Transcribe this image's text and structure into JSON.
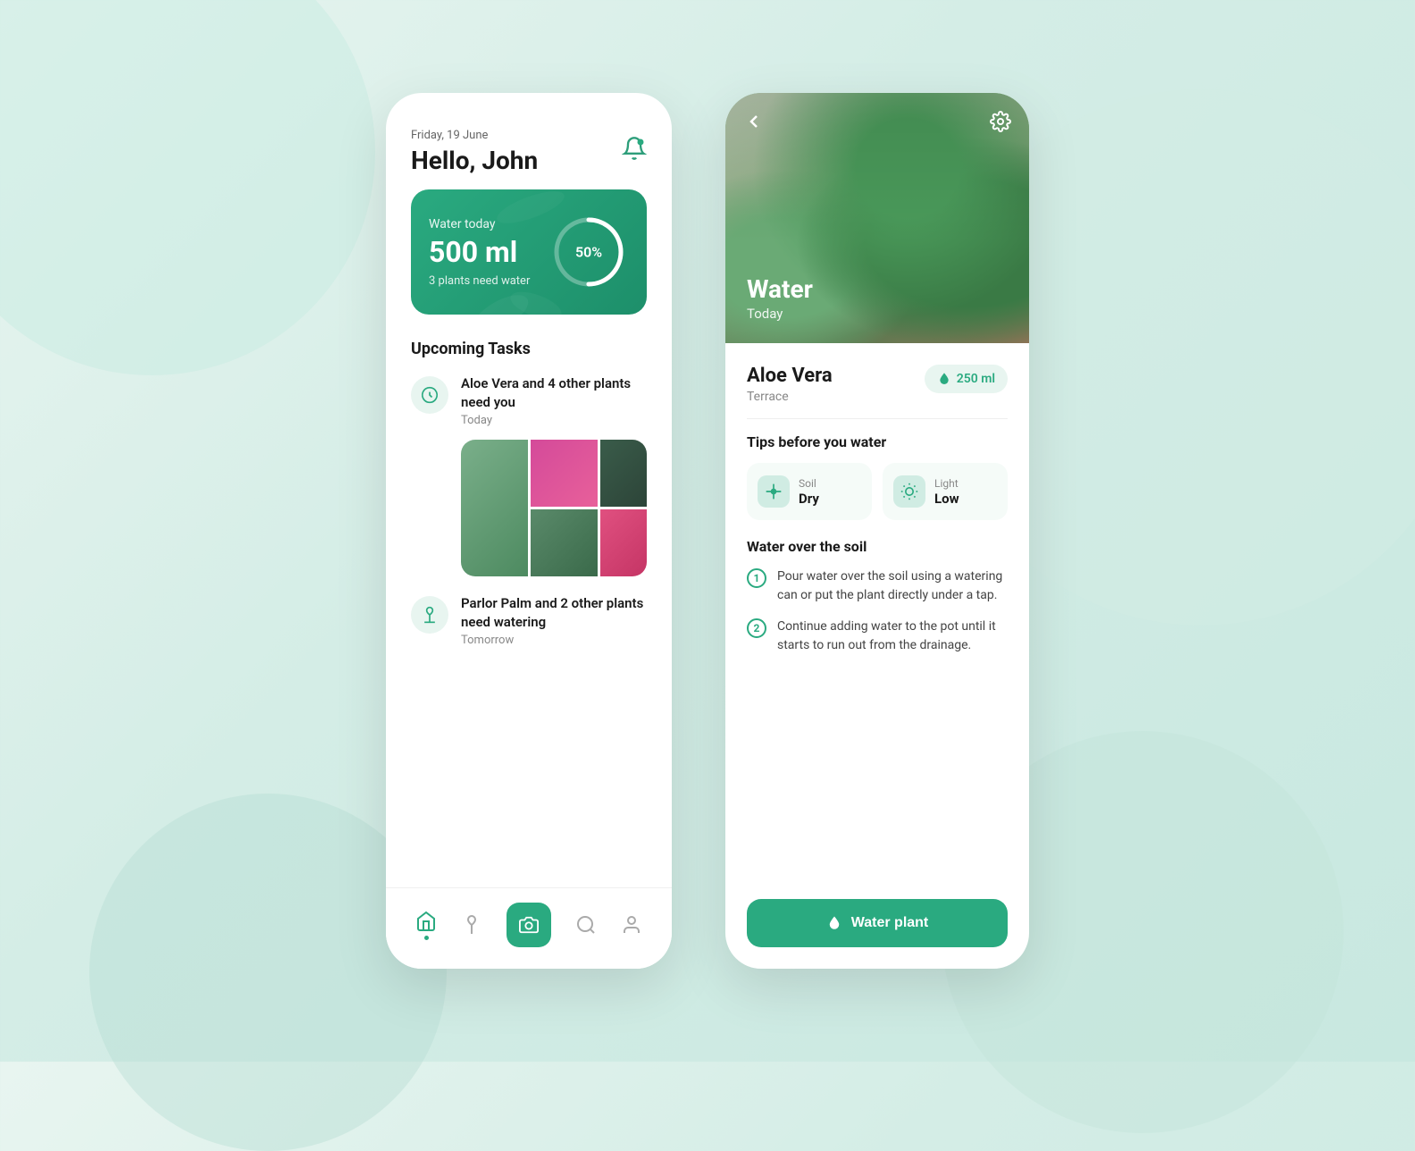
{
  "background": {
    "color": "#d4ede6"
  },
  "phone1": {
    "header": {
      "date": "Friday, 19 June",
      "greeting": "Hello, John"
    },
    "water_card": {
      "label": "Water today",
      "amount": "500 ml",
      "plants_text": "3 plants need water",
      "progress": "50%",
      "progress_value": 50
    },
    "upcoming_tasks": {
      "title": "Upcoming Tasks",
      "task1": {
        "title": "Aloe Vera and 4 other plants need you",
        "time": "Today"
      },
      "task2": {
        "title": "Parlor Palm and 2 other plants need watering",
        "time": "Tomorrow"
      }
    },
    "nav": {
      "home": "Home",
      "plant": "Plant",
      "camera": "Camera",
      "search": "Search",
      "profile": "Profile"
    }
  },
  "phone2": {
    "hero": {
      "action": "Water",
      "sub": "Today"
    },
    "plant": {
      "name": "Aloe Vera",
      "location": "Terrace",
      "water_amount": "250 ml"
    },
    "tips": {
      "title": "Tips before you water",
      "soil": {
        "label": "Soil",
        "value": "Dry"
      },
      "light": {
        "label": "Light",
        "value": "Low"
      }
    },
    "instructions": {
      "title": "Water over the soil",
      "step1": "Pour water over the soil using a watering can or put the plant directly under a tap.",
      "step2": "Continue adding water to the pot until it starts to run out from the drainage."
    },
    "button": {
      "label": "Water plant"
    }
  }
}
